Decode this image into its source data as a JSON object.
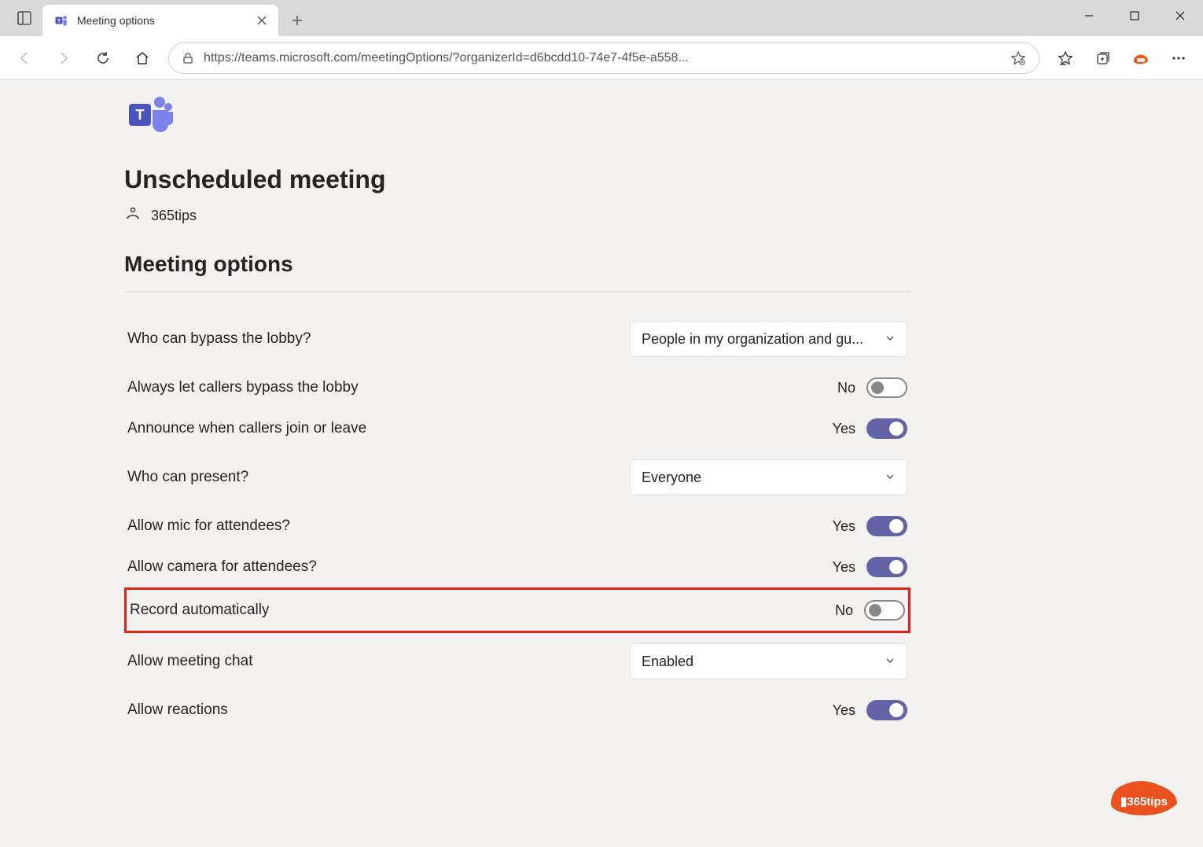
{
  "window": {
    "tab_title": "Meeting options",
    "url": "https://teams.microsoft.com/meetingOptions/?organizerId=d6bcdd10-74e7-4f5e-a558..."
  },
  "page": {
    "title": "Unscheduled meeting",
    "organizer": "365tips",
    "section_title": "Meeting options"
  },
  "options": [
    {
      "label": "Who can bypass the lobby?",
      "type": "select",
      "value": "People in my organization and gu..."
    },
    {
      "label": "Always let callers bypass the lobby",
      "type": "toggle",
      "value": false,
      "text": "No"
    },
    {
      "label": "Announce when callers join or leave",
      "type": "toggle",
      "value": true,
      "text": "Yes"
    },
    {
      "label": "Who can present?",
      "type": "select",
      "value": "Everyone"
    },
    {
      "label": "Allow mic for attendees?",
      "type": "toggle",
      "value": true,
      "text": "Yes"
    },
    {
      "label": "Allow camera for attendees?",
      "type": "toggle",
      "value": true,
      "text": "Yes"
    },
    {
      "label": "Record automatically",
      "type": "toggle",
      "value": false,
      "text": "No",
      "highlight": true
    },
    {
      "label": "Allow meeting chat",
      "type": "select",
      "value": "Enabled"
    },
    {
      "label": "Allow reactions",
      "type": "toggle",
      "value": true,
      "text": "Yes"
    }
  ],
  "watermark": "365tips"
}
